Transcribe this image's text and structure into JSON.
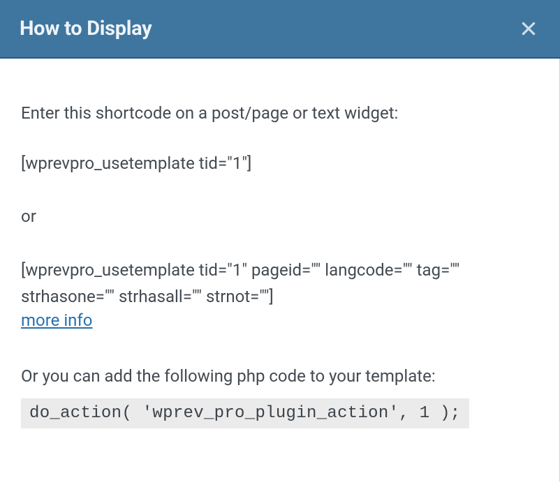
{
  "header": {
    "title": "How to Display"
  },
  "body": {
    "intro": "Enter this shortcode on a post/page or text widget:",
    "shortcode1": "[wprevpro_usetemplate tid=\"1\"]",
    "or": "or",
    "shortcode2": "[wprevpro_usetemplate tid=\"1\" pageid=\"\" langcode=\"\" tag=\"\" strhasone=\"\" strhasall=\"\" strnot=\"\"]",
    "moreinfo": "more info",
    "phpIntro": "Or you can add the following php code to your template:",
    "phpCode": "do_action( 'wprev_pro_plugin_action', 1 );"
  }
}
